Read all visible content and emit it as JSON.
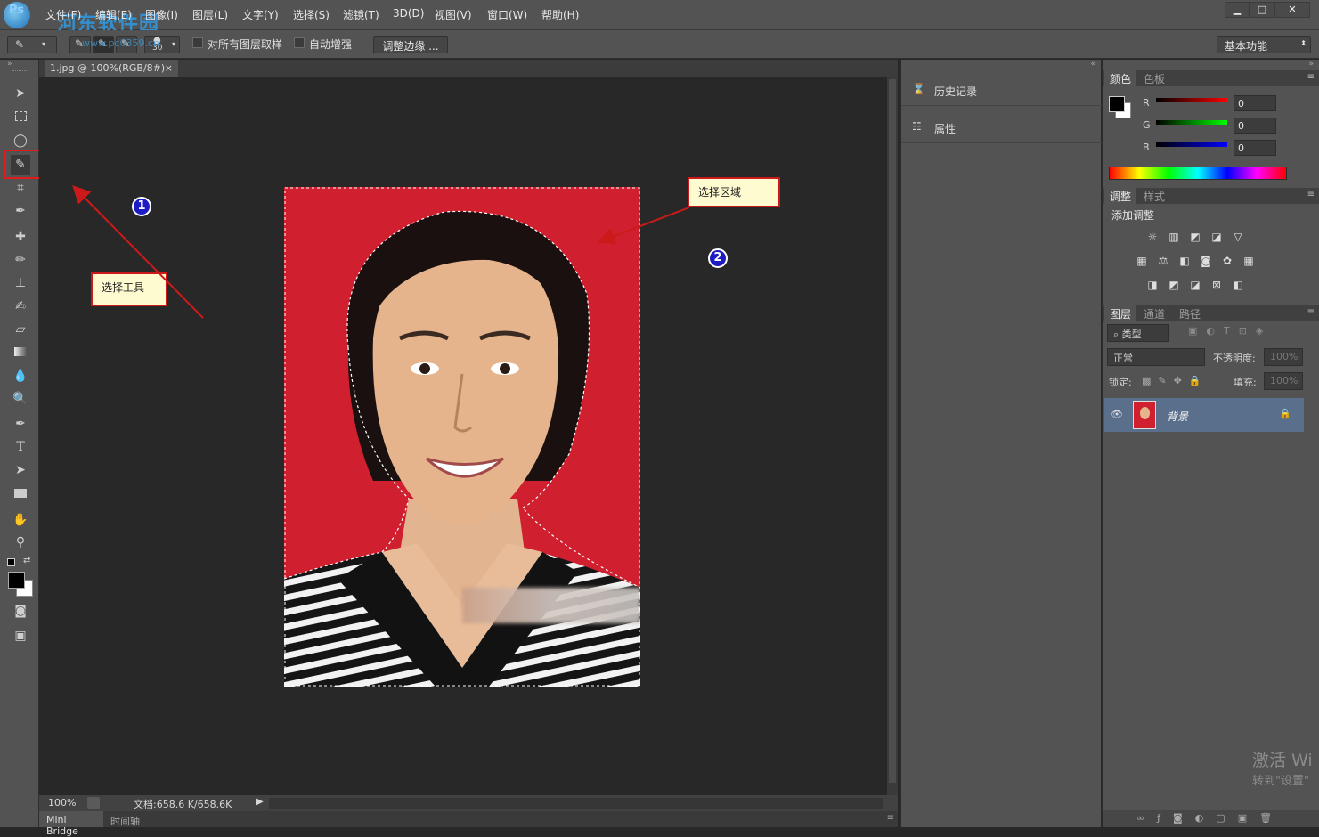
{
  "app": {
    "logo_text": "Ps",
    "watermark_line1": "河东软件园",
    "watermark_line2": "www.pc0359.cn"
  },
  "menu": [
    "文件(F)",
    "编辑(E)",
    "图像(I)",
    "图层(L)",
    "文字(Y)",
    "选择(S)",
    "滤镜(T)",
    "3D(D)",
    "视图(V)",
    "窗口(W)",
    "帮助(H)"
  ],
  "window_controls": {
    "minimize": "▁",
    "maximize": "□",
    "close": "✕"
  },
  "options": {
    "brush_size": "30",
    "sample_all_layers": "对所有图层取样",
    "auto_enhance": "自动增强",
    "refine_edge": "调整边缘 ...",
    "workspace": "基本功能"
  },
  "document": {
    "tab_title": "1.jpg @ 100%(RGB/8#)",
    "tab_close": "×",
    "zoom": "100%",
    "doc_size": "文档:658.6 K/658.6K"
  },
  "bottom_tabs": [
    "Mini Bridge",
    "时间轴"
  ],
  "annotations": {
    "callout_tool": "选择工具",
    "callout_area": "选择区域",
    "badge_1": "1",
    "badge_2": "2"
  },
  "mid_panel": {
    "history": "历史记录",
    "properties": "属性"
  },
  "color_panel": {
    "tabs": [
      "颜色",
      "色板"
    ],
    "r_label": "R",
    "g_label": "G",
    "b_label": "B",
    "r_value": "0",
    "g_value": "0",
    "b_value": "0",
    "foreground": "#000000",
    "background": "#ffffff"
  },
  "adjust_panel": {
    "tabs": [
      "调整",
      "样式"
    ],
    "title": "添加调整"
  },
  "layers_panel": {
    "tabs": [
      "图层",
      "通道",
      "路径"
    ],
    "filter_kind": "类型",
    "blend_mode": "正常",
    "opacity_label": "不透明度:",
    "opacity_value": "100%",
    "lock_label": "锁定:",
    "fill_label": "填充:",
    "fill_value": "100%",
    "layer_name": "背景"
  },
  "os_watermark": {
    "line1": "激活 Wi",
    "line2": "转到\"设置\""
  },
  "colors": {
    "photo_bg_red": "#d01f2e",
    "accent_red": "#cc1a1a",
    "badge_blue": "#1c1cc2",
    "selected_layer": "#5a6f8c"
  }
}
